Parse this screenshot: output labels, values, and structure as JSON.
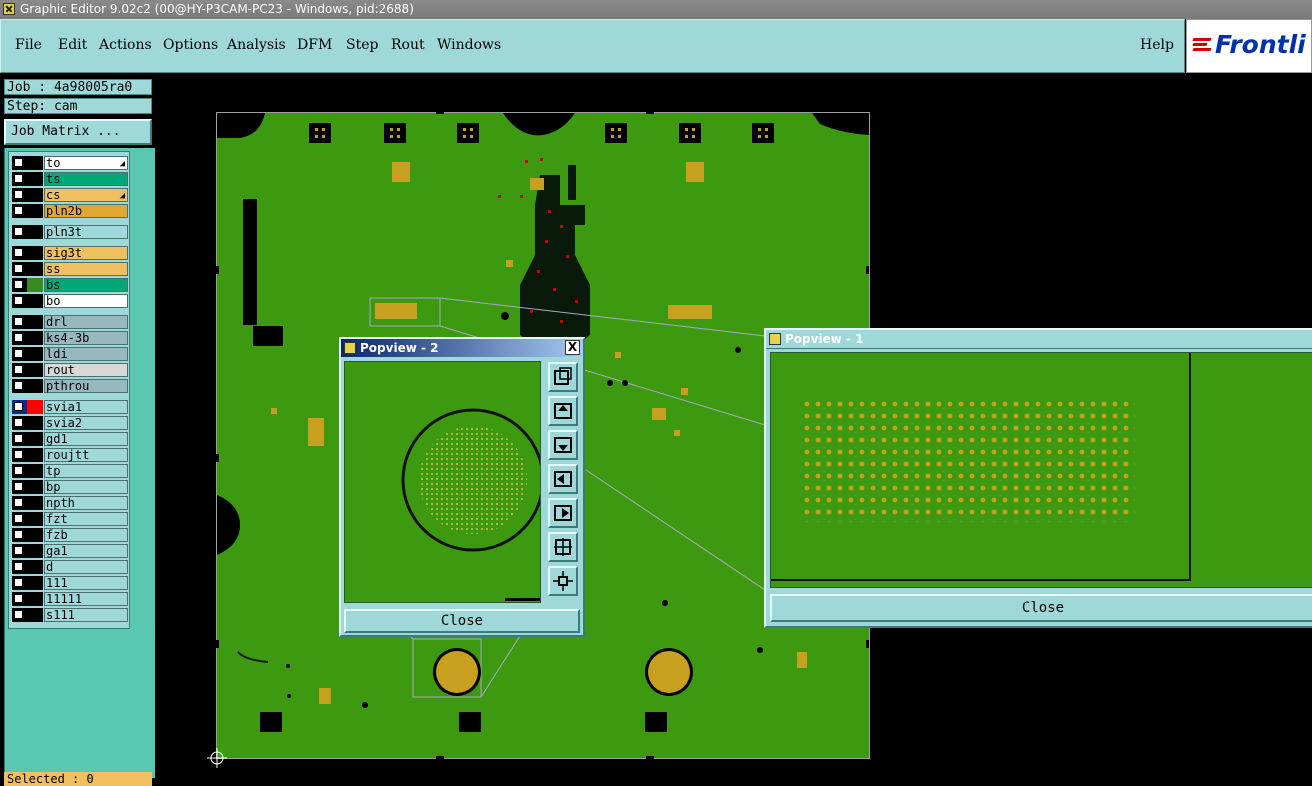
{
  "window": {
    "title": "Graphic Editor 9.02c2 (00@HY-P3CAM-PC23 - Windows, pid:2688)"
  },
  "menu": {
    "items": [
      "File",
      "Edit",
      "Actions",
      "Options",
      "Analysis",
      "DFM",
      "Step",
      "Rout",
      "Windows"
    ],
    "help": "Help"
  },
  "logo": {
    "text": "Frontli"
  },
  "job": {
    "label": "Job : 4a98005ra0",
    "step": "Step: cam",
    "matrix_button": "Job Matrix ..."
  },
  "layers": [
    {
      "name": "to",
      "color": "#ffffff",
      "mark": true
    },
    {
      "name": "ts",
      "color": "#00a878"
    },
    {
      "name": "cs",
      "color": "#f0c060",
      "mark": true
    },
    {
      "name": "pln2b",
      "color": "#e0a830"
    },
    {
      "name": "pln3t",
      "color": "#9ed8d8"
    },
    {
      "name": "sig3t",
      "color": "#f0c060"
    },
    {
      "name": "ss",
      "color": "#f0c060"
    },
    {
      "name": "bs",
      "color": "#00a878",
      "swatch": "#3a8a20"
    },
    {
      "name": "bo",
      "color": "#ffffff"
    },
    {
      "name": "drl",
      "color": "#98b8c0"
    },
    {
      "name": "ks4-3b",
      "color": "#98b8c0"
    },
    {
      "name": "ldi",
      "color": "#98b8c0"
    },
    {
      "name": "rout",
      "color": "#d8d8d8"
    },
    {
      "name": "pthrou",
      "color": "#98b8c0"
    },
    {
      "name": "svia1",
      "color": "#9ed8d8",
      "active": true,
      "swatch": "#ff0000"
    },
    {
      "name": "svia2",
      "color": "#9ed8d8"
    },
    {
      "name": "gd1",
      "color": "#9ed8d8"
    },
    {
      "name": "roujtt",
      "color": "#9ed8d8"
    },
    {
      "name": "tp",
      "color": "#9ed8d8"
    },
    {
      "name": "bp",
      "color": "#9ed8d8"
    },
    {
      "name": "npth",
      "color": "#9ed8d8"
    },
    {
      "name": "fzt",
      "color": "#9ed8d8"
    },
    {
      "name": "fzb",
      "color": "#9ed8d8"
    },
    {
      "name": "ga1",
      "color": "#9ed8d8"
    },
    {
      "name": "d",
      "color": "#9ed8d8"
    },
    {
      "name": "111",
      "color": "#9ed8d8"
    },
    {
      "name": "11111",
      "color": "#9ed8d8"
    },
    {
      "name": "s111",
      "color": "#9ed8d8"
    }
  ],
  "status": {
    "selected": "Selected : 0"
  },
  "popview2": {
    "title": "Popview - 2",
    "close": "Close",
    "close_x": "X"
  },
  "popview1": {
    "title": "Popview - 1",
    "close": "Close"
  },
  "colors": {
    "board": "#3d9a10",
    "pad": "#c8a020",
    "panel": "#9ed8d8",
    "layer_panel": "#5ac8b0"
  }
}
